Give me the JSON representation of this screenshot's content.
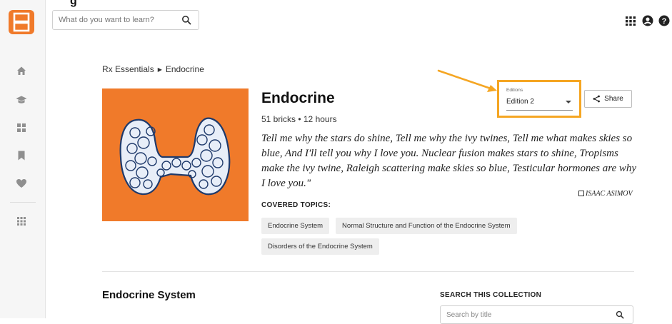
{
  "top_fragment": "g",
  "search": {
    "placeholder": "What do you want to learn?"
  },
  "breadcrumb": {
    "root": "Rx Essentials",
    "current": "Endocrine"
  },
  "course": {
    "title": "Endocrine",
    "meta": "51 bricks • 12 hours",
    "quote": "Tell me why the stars do shine, Tell me why the ivy twines, Tell me what makes skies so blue, And I'll tell you why I love you. Nuclear fusion makes stars to shine, Tropisms make the ivy twine, Raleigh scattering make skies so blue, Testicular hormones are why I love you.\"",
    "author": "ISAAC ASIMOV",
    "covered_label": "COVERED TOPICS:",
    "topics": [
      "Endocrine System",
      "Normal Structure and Function of the Endocrine System",
      "Disorders of the Endocrine System"
    ]
  },
  "editions": {
    "label": "Editions",
    "selected": "Edition 2"
  },
  "share": {
    "label": "Share"
  },
  "section": {
    "title": "Endocrine System",
    "collection_title": "SEARCH THIS COLLECTION",
    "collection_placeholder": "Search by title"
  },
  "colors": {
    "brand_orange": "#f07a2a",
    "highlight": "#f5a623",
    "chip_bg": "#eeeeee",
    "rail_bg": "#f6f6f6"
  },
  "icons": {
    "logo": "brainscape-logo",
    "rail": [
      "home-icon",
      "graduation-cap-icon",
      "dashboard-icon",
      "bookmark-icon",
      "heart-icon",
      "apps-grid-icon"
    ],
    "top_right": [
      "apps-grid-icon",
      "user-icon",
      "help-icon"
    ]
  }
}
